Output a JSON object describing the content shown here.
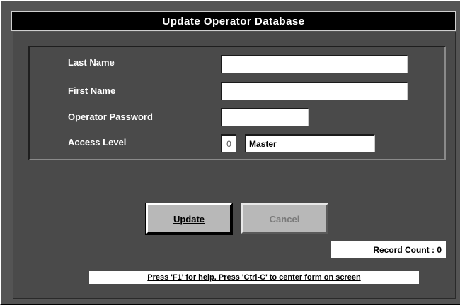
{
  "window": {
    "title": "Update Operator Database"
  },
  "form": {
    "last_name": {
      "label": "Last Name",
      "value": ""
    },
    "first_name": {
      "label": "First Name",
      "value": ""
    },
    "password": {
      "label": "Operator Password",
      "value": ""
    },
    "access_level": {
      "label": "Access Level",
      "code": "0",
      "name": "Master"
    }
  },
  "buttons": {
    "update": "Update",
    "cancel": "Cancel"
  },
  "status": {
    "record_count": "Record Count : 0",
    "help": "Press 'F1' for help. Press 'Ctrl-C' to center form on screen"
  }
}
